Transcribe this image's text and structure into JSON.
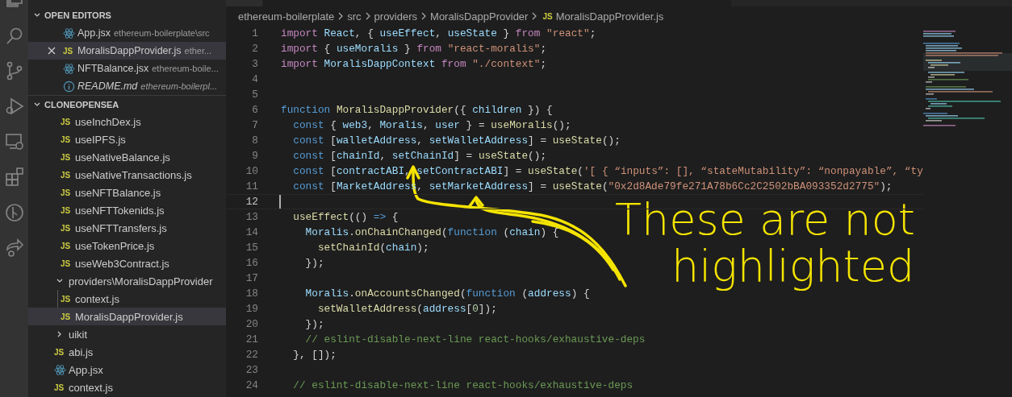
{
  "open_editors": {
    "title": "OPEN EDITORS",
    "expanded": true,
    "items": [
      {
        "kind": "react",
        "name": "App.jsx",
        "path": "ethereum-boilerplate\\src",
        "selected": false,
        "preview": false
      },
      {
        "kind": "js",
        "badge": "JS",
        "name": "MoralisDappProvider.js",
        "path": "ether...",
        "selected": true,
        "preview": false
      },
      {
        "kind": "react",
        "name": "NFTBalance.jsx",
        "path": "ethereum-boile...",
        "selected": false,
        "preview": false
      },
      {
        "kind": "info",
        "name": "README.md",
        "path": "ethereum-boilerpl...",
        "selected": false,
        "preview": true
      }
    ]
  },
  "explorer": {
    "title": "CLONEOPENSEA",
    "expanded": true,
    "tree": [
      {
        "kind": "group",
        "children": [
          {
            "kind": "js",
            "badge": "JS",
            "name": "useInchDex.js",
            "selected": false
          },
          {
            "kind": "js",
            "badge": "JS",
            "name": "useIPFS.js",
            "selected": false
          },
          {
            "kind": "js",
            "badge": "JS",
            "name": "useNativeBalance.js",
            "selected": false
          },
          {
            "kind": "js",
            "badge": "JS",
            "name": "useNativeTransactions.js",
            "selected": false
          },
          {
            "kind": "js",
            "badge": "JS",
            "name": "useNFTBalance.js",
            "selected": false
          },
          {
            "kind": "js",
            "badge": "JS",
            "name": "useNFTTokenids.js",
            "selected": false
          },
          {
            "kind": "js",
            "badge": "JS",
            "name": "useNFTTransfers.js",
            "selected": false
          },
          {
            "kind": "js",
            "badge": "JS",
            "name": "useTokenPrice.js",
            "selected": false
          },
          {
            "kind": "js",
            "badge": "JS",
            "name": "useWeb3Contract.js",
            "selected": false
          }
        ]
      },
      {
        "kind": "folder",
        "name": "providers\\MoralisDappProvider",
        "expanded": true,
        "selected": false,
        "children": [
          {
            "kind": "js",
            "badge": "JS",
            "name": "context.js",
            "selected": false
          },
          {
            "kind": "js",
            "badge": "JS",
            "name": "MoralisDappProvider.js",
            "selected": true
          }
        ]
      },
      {
        "kind": "folder",
        "name": "uikit",
        "expanded": false,
        "selected": false
      },
      {
        "kind": "js",
        "badge": "JS",
        "name": "abi.js",
        "selected": false
      },
      {
        "kind": "react",
        "name": "App.jsx",
        "selected": false
      },
      {
        "kind": "js",
        "badge": "JS",
        "name": "context.js",
        "selected": false
      }
    ]
  },
  "breadcrumb": {
    "parts": [
      "ethereum-boilerplate",
      "src",
      "providers",
      "MoralisDappProvider"
    ],
    "file_badge": "JS",
    "file": "MoralisDappProvider.js"
  },
  "editor": {
    "lines": [
      {
        "number": "1",
        "current": false,
        "tokens": [
          {
            "kind": "kw",
            "text": "import "
          },
          {
            "kind": "var",
            "text": "React"
          },
          {
            "kind": "plain",
            "text": ", { "
          },
          {
            "kind": "var",
            "text": "useEffect"
          },
          {
            "kind": "plain",
            "text": ", "
          },
          {
            "kind": "var",
            "text": "useState"
          },
          {
            "kind": "plain",
            "text": " } "
          },
          {
            "kind": "kw",
            "text": "from "
          },
          {
            "kind": "str",
            "text": "\"react\""
          },
          {
            "kind": "plain",
            "text": ";"
          }
        ]
      },
      {
        "number": "2",
        "current": false,
        "tokens": [
          {
            "kind": "kw",
            "text": "import"
          },
          {
            "kind": "plain",
            "text": " { "
          },
          {
            "kind": "var",
            "text": "useMoralis"
          },
          {
            "kind": "plain",
            "text": " } "
          },
          {
            "kind": "kw",
            "text": "from "
          },
          {
            "kind": "str",
            "text": "\"react-moralis\""
          },
          {
            "kind": "plain",
            "text": ";"
          }
        ]
      },
      {
        "number": "3",
        "current": false,
        "tokens": [
          {
            "kind": "kw",
            "text": "import "
          },
          {
            "kind": "var",
            "text": "MoralisDappContext "
          },
          {
            "kind": "kw",
            "text": "from "
          },
          {
            "kind": "str",
            "text": "\"./context\""
          },
          {
            "kind": "plain",
            "text": ";"
          }
        ]
      },
      {
        "number": "4",
        "current": false
      },
      {
        "number": "5",
        "current": false
      },
      {
        "number": "6",
        "current": false,
        "tokens": [
          {
            "kind": "storage",
            "text": "function "
          },
          {
            "kind": "fn",
            "text": "MoralisDappProvider"
          },
          {
            "kind": "plain",
            "text": "({ "
          },
          {
            "kind": "var",
            "text": "children"
          },
          {
            "kind": "plain",
            "text": " }) {"
          }
        ]
      },
      {
        "number": "7",
        "current": false,
        "tokens": [
          {
            "kind": "storage",
            "text": "  const"
          },
          {
            "kind": "plain",
            "text": " { "
          },
          {
            "kind": "var",
            "text": "web3"
          },
          {
            "kind": "plain",
            "text": ", "
          },
          {
            "kind": "var",
            "text": "Moralis"
          },
          {
            "kind": "plain",
            "text": ", "
          },
          {
            "kind": "var",
            "text": "user"
          },
          {
            "kind": "plain",
            "text": " } = "
          },
          {
            "kind": "fn",
            "text": "useMoralis"
          },
          {
            "kind": "plain",
            "text": "();"
          }
        ]
      },
      {
        "number": "8",
        "current": false,
        "tokens": [
          {
            "kind": "storage",
            "text": "  const"
          },
          {
            "kind": "plain",
            "text": " ["
          },
          {
            "kind": "var",
            "text": "walletAddress"
          },
          {
            "kind": "plain",
            "text": ", "
          },
          {
            "kind": "var",
            "text": "setWalletAddress"
          },
          {
            "kind": "plain",
            "text": "] = "
          },
          {
            "kind": "fn",
            "text": "useState"
          },
          {
            "kind": "plain",
            "text": "();"
          }
        ]
      },
      {
        "number": "9",
        "current": false,
        "tokens": [
          {
            "kind": "storage",
            "text": "  const"
          },
          {
            "kind": "plain",
            "text": " ["
          },
          {
            "kind": "var",
            "text": "chainId"
          },
          {
            "kind": "plain",
            "text": ", "
          },
          {
            "kind": "var",
            "text": "setChainId"
          },
          {
            "kind": "plain",
            "text": "] = "
          },
          {
            "kind": "fn",
            "text": "useState"
          },
          {
            "kind": "plain",
            "text": "();"
          }
        ]
      },
      {
        "number": "10",
        "current": false,
        "tokens": [
          {
            "kind": "storage",
            "text": "  const"
          },
          {
            "kind": "plain",
            "text": " ["
          },
          {
            "kind": "var",
            "text": "contractABI"
          },
          {
            "kind": "plain",
            "text": ", "
          },
          {
            "kind": "var",
            "text": "setContractABI"
          },
          {
            "kind": "plain",
            "text": "] = "
          },
          {
            "kind": "fn",
            "text": "useState"
          },
          {
            "kind": "plain",
            "text": "("
          },
          {
            "kind": "str",
            "text": "'[ { “inputs”: [], “stateMutability”: “nonpayable”, “ty"
          }
        ]
      },
      {
        "number": "11",
        "current": false,
        "tokens": [
          {
            "kind": "storage",
            "text": "  const"
          },
          {
            "kind": "plain",
            "text": " ["
          },
          {
            "kind": "var",
            "text": "MarketAddress"
          },
          {
            "kind": "plain",
            "text": ", "
          },
          {
            "kind": "var",
            "text": "setMarketAddress"
          },
          {
            "kind": "plain",
            "text": "] = "
          },
          {
            "kind": "fn",
            "text": "useState"
          },
          {
            "kind": "plain",
            "text": "("
          },
          {
            "kind": "str",
            "text": "\"0x2d8Ade79fe271A78b6Cc2C2502bBA093352d2775\""
          },
          {
            "kind": "plain",
            "text": ");"
          }
        ]
      },
      {
        "number": "12",
        "current": true
      },
      {
        "number": "13",
        "current": false,
        "tokens": [
          {
            "kind": "fn",
            "text": "  useEffect"
          },
          {
            "kind": "plain",
            "text": "(() "
          },
          {
            "kind": "storage",
            "text": "=>"
          },
          {
            "kind": "plain",
            "text": " {"
          }
        ]
      },
      {
        "number": "14",
        "current": false,
        "tokens": [
          {
            "kind": "var",
            "text": "    Moralis"
          },
          {
            "kind": "plain",
            "text": "."
          },
          {
            "kind": "fn",
            "text": "onChainChanged"
          },
          {
            "kind": "plain",
            "text": "("
          },
          {
            "kind": "storage",
            "text": "function"
          },
          {
            "kind": "plain",
            "text": " ("
          },
          {
            "kind": "var",
            "text": "chain"
          },
          {
            "kind": "plain",
            "text": ") {"
          }
        ]
      },
      {
        "number": "15",
        "current": false,
        "tokens": [
          {
            "kind": "fn",
            "text": "      setChainId"
          },
          {
            "kind": "plain",
            "text": "("
          },
          {
            "kind": "var",
            "text": "chain"
          },
          {
            "kind": "plain",
            "text": ");"
          }
        ]
      },
      {
        "number": "16",
        "current": false,
        "tokens": [
          {
            "kind": "plain",
            "text": "    });"
          }
        ]
      },
      {
        "number": "17",
        "current": false
      },
      {
        "number": "18",
        "current": false,
        "tokens": [
          {
            "kind": "var",
            "text": "    Moralis"
          },
          {
            "kind": "plain",
            "text": "."
          },
          {
            "kind": "fn",
            "text": "onAccountsChanged"
          },
          {
            "kind": "plain",
            "text": "("
          },
          {
            "kind": "storage",
            "text": "function"
          },
          {
            "kind": "plain",
            "text": " ("
          },
          {
            "kind": "var",
            "text": "address"
          },
          {
            "kind": "plain",
            "text": ") {"
          }
        ]
      },
      {
        "number": "19",
        "current": false,
        "tokens": [
          {
            "kind": "fn",
            "text": "      setWalletAddress"
          },
          {
            "kind": "plain",
            "text": "("
          },
          {
            "kind": "var",
            "text": "address"
          },
          {
            "kind": "plain",
            "text": "["
          },
          {
            "kind": "num",
            "text": "0"
          },
          {
            "kind": "plain",
            "text": "]);"
          }
        ]
      },
      {
        "number": "20",
        "current": false,
        "tokens": [
          {
            "kind": "plain",
            "text": "    });"
          }
        ]
      },
      {
        "number": "21",
        "current": false,
        "tokens": [
          {
            "kind": "comment",
            "text": "    // eslint-disable-next-line react-hooks/exhaustive-deps"
          }
        ]
      },
      {
        "number": "22",
        "current": false,
        "tokens": [
          {
            "kind": "plain",
            "text": "  }, []);"
          }
        ]
      },
      {
        "number": "23",
        "current": false
      },
      {
        "number": "24",
        "current": false,
        "tokens": [
          {
            "kind": "comment",
            "text": "  // eslint-disable-next-line react-hooks/exhaustive-deps"
          }
        ]
      }
    ]
  },
  "annotation": {
    "lines": [
      "These are not",
      "highlighted"
    ]
  }
}
